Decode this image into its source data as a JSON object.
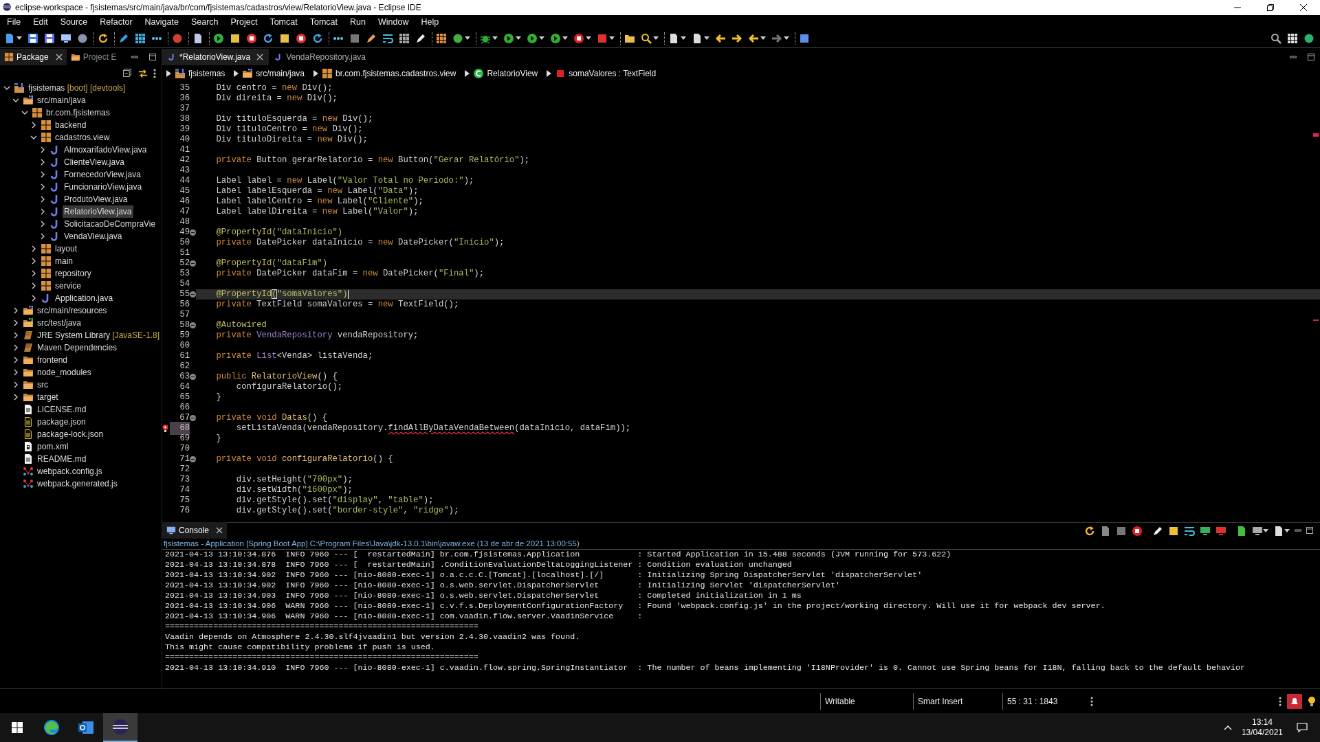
{
  "window": {
    "title": "eclipse-workspace - fjsistemas/src/main/java/br/com/fjsistemas/cadastros/view/RelatorioView.java - Eclipse IDE"
  },
  "menu": [
    "File",
    "Edit",
    "Source",
    "Refactor",
    "Navigate",
    "Search",
    "Project",
    "Tomcat",
    "Tomcat",
    "Run",
    "Window",
    "Help"
  ],
  "explorer": {
    "tabs": [
      {
        "label": "Package",
        "selected": true
      },
      {
        "label": "Project E",
        "selected": false
      }
    ],
    "tree": [
      {
        "label": "fjsistemas",
        "decoration": "[boot] [devtools]",
        "kind": "project",
        "expanded": true,
        "selected": false,
        "children": [
          {
            "label": "src/main/java",
            "kind": "source-folder",
            "expanded": true,
            "selected": false,
            "children": [
              {
                "label": "br.com.fjsistemas",
                "kind": "package",
                "expanded": true,
                "selected": false,
                "children": [
                  {
                    "label": "backend",
                    "kind": "package",
                    "expanded": false,
                    "selected": false
                  },
                  {
                    "label": "cadastros.view",
                    "kind": "package",
                    "expanded": true,
                    "selected": false,
                    "children": [
                      {
                        "label": "AlmoxarifadoView.java",
                        "kind": "java",
                        "expanded": false,
                        "selected": false
                      },
                      {
                        "label": "ClienteView.java",
                        "kind": "java",
                        "expanded": false,
                        "selected": false
                      },
                      {
                        "label": "FornecedorView.java",
                        "kind": "java",
                        "expanded": false,
                        "selected": false
                      },
                      {
                        "label": "FuncionarioView.java",
                        "kind": "java",
                        "expanded": false,
                        "selected": false
                      },
                      {
                        "label": "ProdutoView.java",
                        "kind": "java",
                        "expanded": false,
                        "selected": false
                      },
                      {
                        "label": "RelatorioView.java",
                        "kind": "java",
                        "expanded": false,
                        "selected": true
                      },
                      {
                        "label": "SolicitacaoDeCompraVie",
                        "kind": "java",
                        "expanded": false,
                        "selected": false
                      },
                      {
                        "label": "VendaView.java",
                        "kind": "java",
                        "expanded": false,
                        "selected": false
                      }
                    ]
                  },
                  {
                    "label": "layout",
                    "kind": "package",
                    "expanded": false,
                    "selected": false
                  },
                  {
                    "label": "main",
                    "kind": "package",
                    "expanded": false,
                    "selected": false
                  },
                  {
                    "label": "repository",
                    "kind": "package",
                    "expanded": false,
                    "selected": false
                  },
                  {
                    "label": "service",
                    "kind": "package",
                    "expanded": false,
                    "selected": false
                  },
                  {
                    "label": "Application.java",
                    "kind": "java",
                    "expanded": false,
                    "selected": false
                  }
                ]
              }
            ]
          },
          {
            "label": "src/main/resources",
            "kind": "source-folder",
            "expanded": false,
            "selected": false
          },
          {
            "label": "src/test/java",
            "kind": "test-folder",
            "expanded": false,
            "selected": false
          },
          {
            "label": "JRE System Library",
            "decoration": "[JavaSE-1.8]",
            "kind": "library",
            "expanded": false,
            "selected": false
          },
          {
            "label": "Maven Dependencies",
            "kind": "library",
            "expanded": false,
            "selected": false
          },
          {
            "label": "frontend",
            "kind": "folder",
            "expanded": false,
            "selected": false
          },
          {
            "label": "node_modules",
            "kind": "folder",
            "expanded": false,
            "selected": false
          },
          {
            "label": "src",
            "kind": "folder",
            "expanded": false,
            "selected": false
          },
          {
            "label": "target",
            "kind": "folder",
            "expanded": false,
            "selected": false
          },
          {
            "label": "LICENSE.md",
            "kind": "file",
            "selected": false
          },
          {
            "label": "package.json",
            "kind": "json",
            "selected": false
          },
          {
            "label": "package-lock.json",
            "kind": "json",
            "selected": false
          },
          {
            "label": "pom.xml",
            "kind": "pom",
            "selected": false
          },
          {
            "label": "README.md",
            "kind": "file",
            "selected": false
          },
          {
            "label": "webpack.config.js",
            "kind": "webpack",
            "selected": false
          },
          {
            "label": "webpack.generated.js",
            "kind": "webpack",
            "selected": false
          }
        ]
      }
    ]
  },
  "editor": {
    "tabs": [
      {
        "label": "*RelatorioView.java",
        "selected": true
      },
      {
        "label": "VendaRepository.java",
        "selected": false
      }
    ],
    "breadcrumb": [
      {
        "label": "fjsistemas",
        "kind": "project"
      },
      {
        "label": "src/main/java",
        "kind": "source-folder"
      },
      {
        "label": "br.com.fjsistemas.cadastros.view",
        "kind": "package"
      },
      {
        "label": "RelatorioView",
        "kind": "class"
      },
      {
        "label": "somaValores : TextField",
        "kind": "field"
      }
    ],
    "lines": [
      {
        "number": "35",
        "fold": false,
        "current": false,
        "error": false,
        "segments": [
          {
            "kind": "plain",
            "text": "    Div centro = "
          },
          {
            "kind": "keyword",
            "text": "new"
          },
          {
            "kind": "plain",
            "text": " Div();"
          }
        ]
      },
      {
        "number": "36",
        "fold": false,
        "current": false,
        "error": false,
        "segments": [
          {
            "kind": "plain",
            "text": "    Div direita = "
          },
          {
            "kind": "keyword",
            "text": "new"
          },
          {
            "kind": "plain",
            "text": " Div();"
          }
        ]
      },
      {
        "number": "37",
        "fold": false,
        "current": false,
        "error": false
      },
      {
        "number": "38",
        "fold": false,
        "current": false,
        "error": false,
        "segments": [
          {
            "kind": "plain",
            "text": "    Div tituloEsquerda = "
          },
          {
            "kind": "keyword",
            "text": "new"
          },
          {
            "kind": "plain",
            "text": " Div();"
          }
        ]
      },
      {
        "number": "39",
        "fold": false,
        "current": false,
        "error": false,
        "segments": [
          {
            "kind": "plain",
            "text": "    Div tituloCentro = "
          },
          {
            "kind": "keyword",
            "text": "new"
          },
          {
            "kind": "plain",
            "text": " Div();"
          }
        ]
      },
      {
        "number": "40",
        "fold": false,
        "current": false,
        "error": false,
        "segments": [
          {
            "kind": "plain",
            "text": "    Div tituloDireita = "
          },
          {
            "kind": "keyword",
            "text": "new"
          },
          {
            "kind": "plain",
            "text": " Div();"
          }
        ]
      },
      {
        "number": "41",
        "fold": false,
        "current": false,
        "error": false
      },
      {
        "number": "42",
        "fold": false,
        "current": false,
        "error": false,
        "segments": [
          {
            "kind": "keyword",
            "text": "    private"
          },
          {
            "kind": "plain",
            "text": " Button gerarRelatorio = "
          },
          {
            "kind": "keyword",
            "text": "new"
          },
          {
            "kind": "plain",
            "text": " Button("
          },
          {
            "kind": "string",
            "text": "\"Gerar Relatório\""
          },
          {
            "kind": "plain",
            "text": ");"
          }
        ]
      },
      {
        "number": "43",
        "fold": false,
        "current": false,
        "error": false
      },
      {
        "number": "44",
        "fold": false,
        "current": false,
        "error": false,
        "segments": [
          {
            "kind": "plain",
            "text": "    Label label = "
          },
          {
            "kind": "keyword",
            "text": "new"
          },
          {
            "kind": "plain",
            "text": " Label("
          },
          {
            "kind": "string",
            "text": "\"Valor Total no Periodo:\""
          },
          {
            "kind": "plain",
            "text": ");"
          }
        ]
      },
      {
        "number": "45",
        "fold": false,
        "current": false,
        "error": false,
        "segments": [
          {
            "kind": "plain",
            "text": "    Label labelEsquerda = "
          },
          {
            "kind": "keyword",
            "text": "new"
          },
          {
            "kind": "plain",
            "text": " Label("
          },
          {
            "kind": "string",
            "text": "\"Data\""
          },
          {
            "kind": "plain",
            "text": ");"
          }
        ]
      },
      {
        "number": "46",
        "fold": false,
        "current": false,
        "error": false,
        "segments": [
          {
            "kind": "plain",
            "text": "    Label labelCentro = "
          },
          {
            "kind": "keyword",
            "text": "new"
          },
          {
            "kind": "plain",
            "text": " Label("
          },
          {
            "kind": "string",
            "text": "\"Cliente\""
          },
          {
            "kind": "plain",
            "text": ");"
          }
        ]
      },
      {
        "number": "47",
        "fold": false,
        "current": false,
        "error": false,
        "segments": [
          {
            "kind": "plain",
            "text": "    Label labelDireita = "
          },
          {
            "kind": "keyword",
            "text": "new"
          },
          {
            "kind": "plain",
            "text": " Label("
          },
          {
            "kind": "string",
            "text": "\"Valor\""
          },
          {
            "kind": "plain",
            "text": ");"
          }
        ]
      },
      {
        "number": "48",
        "fold": false,
        "current": false,
        "error": false
      },
      {
        "number": "49",
        "fold": true,
        "current": false,
        "error": false,
        "segments": [
          {
            "kind": "annotation",
            "text": "    @PropertyId("
          },
          {
            "kind": "string",
            "text": "\"dataInicio\""
          },
          {
            "kind": "annotation",
            "text": ")"
          }
        ]
      },
      {
        "number": "50",
        "fold": false,
        "current": false,
        "error": false,
        "segments": [
          {
            "kind": "keyword",
            "text": "    private"
          },
          {
            "kind": "plain",
            "text": " DatePicker dataInicio = "
          },
          {
            "kind": "keyword",
            "text": "new"
          },
          {
            "kind": "plain",
            "text": " DatePicker("
          },
          {
            "kind": "string",
            "text": "\"Início\""
          },
          {
            "kind": "plain",
            "text": ");"
          }
        ]
      },
      {
        "number": "51",
        "fold": false,
        "current": false,
        "error": false
      },
      {
        "number": "52",
        "fold": true,
        "current": false,
        "error": false,
        "segments": [
          {
            "kind": "annotation",
            "text": "    @PropertyId("
          },
          {
            "kind": "string",
            "text": "\"dataFim\""
          },
          {
            "kind": "annotation",
            "text": ")"
          }
        ]
      },
      {
        "number": "53",
        "fold": false,
        "current": false,
        "error": false,
        "segments": [
          {
            "kind": "keyword",
            "text": "    private"
          },
          {
            "kind": "plain",
            "text": " DatePicker dataFim = "
          },
          {
            "kind": "keyword",
            "text": "new"
          },
          {
            "kind": "plain",
            "text": " DatePicker("
          },
          {
            "kind": "string",
            "text": "\"Final\""
          },
          {
            "kind": "plain",
            "text": ");"
          }
        ]
      },
      {
        "number": "54",
        "fold": false,
        "current": false,
        "error": false
      },
      {
        "number": "55",
        "fold": true,
        "current": true,
        "error": false,
        "segments": [
          {
            "kind": "annotation",
            "text": "    @PropertyId"
          },
          {
            "kind": "bracket",
            "text": "("
          },
          {
            "kind": "string",
            "text": "\"somaValores\""
          },
          {
            "kind": "annotation",
            "text": ")"
          }
        ]
      },
      {
        "number": "56",
        "fold": false,
        "current": false,
        "error": false,
        "segments": [
          {
            "kind": "keyword",
            "text": "    private"
          },
          {
            "kind": "plain",
            "text": " TextField somaValores = "
          },
          {
            "kind": "keyword",
            "text": "new"
          },
          {
            "kind": "plain",
            "text": " TextField();"
          }
        ]
      },
      {
        "number": "57",
        "fold": false,
        "current": false,
        "error": false
      },
      {
        "number": "58",
        "fold": true,
        "current": false,
        "error": false,
        "segments": [
          {
            "kind": "annotation",
            "text": "    @Autowired"
          }
        ]
      },
      {
        "number": "59",
        "fold": false,
        "current": false,
        "error": false,
        "segments": [
          {
            "kind": "keyword",
            "text": "    private"
          },
          {
            "kind": "class",
            "text": " VendaRepository"
          },
          {
            "kind": "plain",
            "text": " vendaRepository;"
          }
        ]
      },
      {
        "number": "60",
        "fold": false,
        "current": false,
        "error": false
      },
      {
        "number": "61",
        "fold": false,
        "current": false,
        "error": false,
        "segments": [
          {
            "kind": "keyword",
            "text": "    private"
          },
          {
            "kind": "class",
            "text": " List"
          },
          {
            "kind": "plain",
            "text": "<Venda> listaVenda;"
          }
        ]
      },
      {
        "number": "62",
        "fold": false,
        "current": false,
        "error": false
      },
      {
        "number": "63",
        "fold": true,
        "current": false,
        "error": false,
        "segments": [
          {
            "kind": "keyword",
            "text": "    public"
          },
          {
            "kind": "method",
            "text": " RelatorioView"
          },
          {
            "kind": "plain",
            "text": "() {"
          }
        ]
      },
      {
        "number": "64",
        "fold": false,
        "current": false,
        "error": false,
        "segments": [
          {
            "kind": "plain",
            "text": "        configuraRelatorio();"
          }
        ]
      },
      {
        "number": "65",
        "fold": false,
        "current": false,
        "error": false,
        "segments": [
          {
            "kind": "plain",
            "text": "    }"
          }
        ]
      },
      {
        "number": "66",
        "fold": false,
        "current": false,
        "error": false
      },
      {
        "number": "67",
        "fold": true,
        "current": false,
        "error": false,
        "segments": [
          {
            "kind": "keyword",
            "text": "    private void"
          },
          {
            "kind": "method",
            "text": " Datas"
          },
          {
            "kind": "plain",
            "text": "() {"
          }
        ]
      },
      {
        "number": "68",
        "fold": false,
        "current": false,
        "error": true,
        "segments": [
          {
            "kind": "plain",
            "text": "        setListaVenda(vendaRepository."
          },
          {
            "kind": "error",
            "text": "findAllByDataVendaBetween"
          },
          {
            "kind": "plain",
            "text": "(dataInicio, dataFim));"
          }
        ]
      },
      {
        "number": "69",
        "fold": false,
        "current": false,
        "error": false,
        "segments": [
          {
            "kind": "plain",
            "text": "    }"
          }
        ]
      },
      {
        "number": "70",
        "fold": false,
        "current": false,
        "error": false
      },
      {
        "number": "71",
        "fold": true,
        "current": false,
        "error": false,
        "segments": [
          {
            "kind": "keyword",
            "text": "    private void"
          },
          {
            "kind": "method",
            "text": " configuraRelatorio"
          },
          {
            "kind": "plain",
            "text": "() {"
          }
        ]
      },
      {
        "number": "72",
        "fold": false,
        "current": false,
        "error": false
      },
      {
        "number": "73",
        "fold": false,
        "current": false,
        "error": false,
        "segments": [
          {
            "kind": "plain",
            "text": "        div.setHeight("
          },
          {
            "kind": "string",
            "text": "\"700px\""
          },
          {
            "kind": "plain",
            "text": ");"
          }
        ]
      },
      {
        "number": "74",
        "fold": false,
        "current": false,
        "error": false,
        "segments": [
          {
            "kind": "plain",
            "text": "        div.setWidth("
          },
          {
            "kind": "string",
            "text": "\"1600px\""
          },
          {
            "kind": "plain",
            "text": ");"
          }
        ]
      },
      {
        "number": "75",
        "fold": false,
        "current": false,
        "error": false,
        "segments": [
          {
            "kind": "plain",
            "text": "        div.getStyle().set("
          },
          {
            "kind": "string",
            "text": "\"display\""
          },
          {
            "kind": "plain",
            "text": ", "
          },
          {
            "kind": "string",
            "text": "\"table\""
          },
          {
            "kind": "plain",
            "text": ");"
          }
        ]
      },
      {
        "number": "76",
        "fold": false,
        "current": false,
        "error": false,
        "segments": [
          {
            "kind": "plain",
            "text": "        div.getStyle().set("
          },
          {
            "kind": "string",
            "text": "\"border-style\""
          },
          {
            "kind": "plain",
            "text": ", "
          },
          {
            "kind": "string",
            "text": "\"ridge\""
          },
          {
            "kind": "plain",
            "text": ");"
          }
        ]
      }
    ]
  },
  "console": {
    "tab": {
      "label": "Console"
    },
    "launch": "fjsistemas - Application [Spring Boot App] C:\\Program Files\\Java\\jdk-13.0.1\\bin\\javaw.exe  (13 de abr de 2021 13:00:55)",
    "lines": [
      "2021-04-13 13:10:34.876  INFO 7960 --- [  restartedMain] br.com.fjsistemas.Application            : Started Application in 15.488 seconds (JVM running for 573.622)",
      "2021-04-13 13:10:34.878  INFO 7960 --- [  restartedMain] .ConditionEvaluationDeltaLoggingListener : Condition evaluation unchanged",
      "2021-04-13 13:10:34.902  INFO 7960 --- [nio-8080-exec-1] o.a.c.c.C.[Tomcat].[localhost].[/]       : Initializing Spring DispatcherServlet 'dispatcherServlet'",
      "2021-04-13 13:10:34.902  INFO 7960 --- [nio-8080-exec-1] o.s.web.servlet.DispatcherServlet        : Initializing Servlet 'dispatcherServlet'",
      "2021-04-13 13:10:34.903  INFO 7960 --- [nio-8080-exec-1] o.s.web.servlet.DispatcherServlet        : Completed initialization in 1 ms",
      "2021-04-13 13:10:34.906  WARN 7960 --- [nio-8080-exec-1] c.v.f.s.DeploymentConfigurationFactory   : Found 'webpack.config.js' in the project/working directory. Will use it for webpack dev server.",
      "2021-04-13 13:10:34.906  WARN 7960 --- [nio-8080-exec-1] com.vaadin.flow.server.VaadinService     :",
      "=================================================================",
      "Vaadin depends on Atmosphere 2.4.30.slf4jvaadin1 but version 2.4.30.vaadin2 was found.",
      "This might cause compatibility problems if push is used.",
      "=================================================================",
      "2021-04-13 13:10:34.910  INFO 7960 --- [nio-8080-exec-1] c.vaadin.flow.spring.SpringInstantiator  : The number of beans implementing 'I18NProvider' is 0. Cannot use Spring beans for I18N, falling back to the default behavior"
    ]
  },
  "status_bar": [
    "Writable",
    "Smart Insert",
    "55 : 31 : 1843"
  ],
  "taskbar": {
    "apps": [
      {
        "kind": "browser",
        "selected": false
      },
      {
        "kind": "mail",
        "selected": false
      },
      {
        "kind": "ide",
        "selected": true
      }
    ],
    "time": "13:14",
    "date": "13/04/2021"
  }
}
